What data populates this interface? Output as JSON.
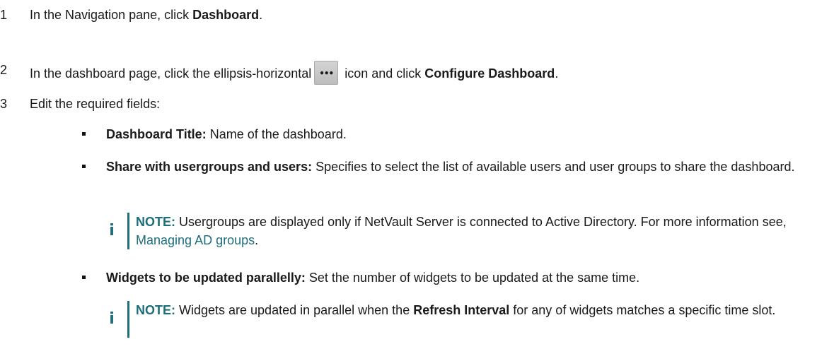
{
  "steps": [
    {
      "number": "1",
      "before": "In the Navigation pane, click ",
      "bold": "Dashboard",
      "after": "."
    },
    {
      "number": "2",
      "before": "In the dashboard page, click the ellipsis-horizontal",
      "icon": "ellipsis-horizontal-icon",
      "icon_glyph": "•••",
      "middle": " icon and click ",
      "bold": "Configure Dashboard",
      "after": "."
    },
    {
      "number": "3",
      "text": "Edit the required fields:"
    }
  ],
  "fields": [
    {
      "label": "Dashboard Title:",
      "description": " Name of the dashboard."
    },
    {
      "label": "Share with usergroups and users:",
      "description": " Specifies to select the list of available users and user groups to share the dashboard."
    },
    {
      "label": "Widgets to be updated parallelly:",
      "description": " Set the number of widgets to be updated at the same time."
    }
  ],
  "notes": [
    {
      "icon": "info-icon",
      "icon_glyph": "i",
      "label": "NOTE:",
      "text1": " Usergroups are displayed only if NetVault Server is connected to Active Directory. For more information see, ",
      "link": "Managing AD groups",
      "text2": "."
    },
    {
      "icon": "info-icon",
      "icon_glyph": "i",
      "label": "NOTE:",
      "text1": " Widgets are updated in parallel when the ",
      "bold": "Refresh Interval",
      "text2": " for any of widgets matches a specific time slot."
    }
  ],
  "colors": {
    "accent": "#1d6d7a",
    "text": "#1a1a1a"
  }
}
